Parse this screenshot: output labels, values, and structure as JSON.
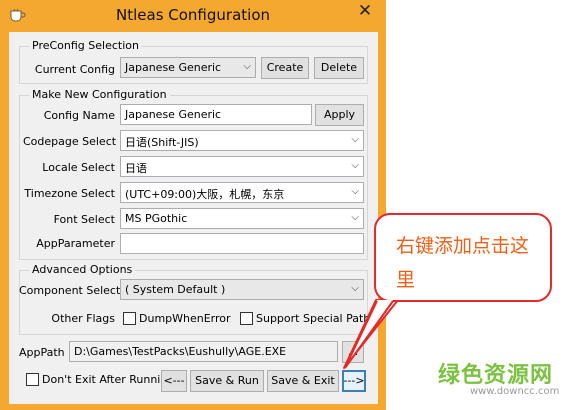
{
  "window": {
    "title": "Ntleas Configuration",
    "close_glyph": "✕"
  },
  "preconfig": {
    "legend": "PreConfig Selection",
    "current_config_label": "Current Config",
    "current_config_value": "Japanese Generic",
    "create_label": "Create",
    "delete_label": "Delete"
  },
  "newconfig": {
    "legend": "Make New Configuration",
    "config_name_label": "Config Name",
    "config_name_value": "Japanese Generic",
    "apply_label": "Apply",
    "codepage_label": "Codepage Select",
    "codepage_value": "日语(Shift-JIS)",
    "locale_label": "Locale Select",
    "locale_value": "日语",
    "timezone_label": "Timezone Select",
    "timezone_value": "(UTC+09:00)大阪，札幌，东京",
    "font_label": "Font Select",
    "font_value": "MS PGothic",
    "appparam_label": "AppParameter",
    "appparam_value": ""
  },
  "advanced": {
    "legend": "Advanced Options",
    "component_label": "Component Select",
    "component_value": "( System Default )",
    "other_flags_label": "Other Flags",
    "dump_label": "DumpWhenError",
    "special_path_label": "Support Special Path"
  },
  "apppath": {
    "label": "AppPath",
    "value": "D:\\Games\\TestPacks\\Eushully\\AGE.EXE",
    "browse_label": "..."
  },
  "footer": {
    "dont_exit_label": "Don't Exit After Running",
    "prev_label": "<---",
    "save_run_label": "Save & Run",
    "save_exit_label": "Save & Exit",
    "next_label": "--->"
  },
  "callout": {
    "text": "右键添加点击这里"
  },
  "watermark": {
    "cn": "绿色资源网",
    "url": "www.downcc.com"
  },
  "icons": [
    "app-icon",
    "close-icon",
    "dropdown-arrow-icon"
  ],
  "colors": {
    "frame": "#f5a830",
    "callout_border": "#e22b2b",
    "callout_text": "#e8611a",
    "watermark": "#7cc242"
  }
}
